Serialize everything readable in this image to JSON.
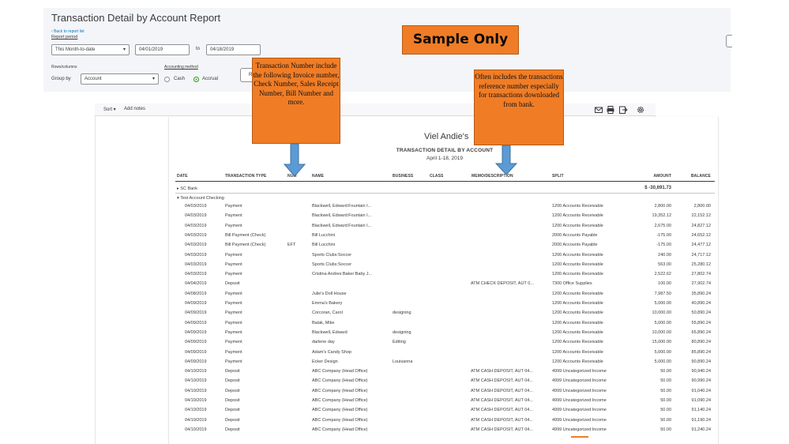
{
  "header": {
    "title": "Transaction Detail by Account Report",
    "back_link": "Back to report list",
    "report_period_label": "Report period",
    "period_value": "This Month-to-date",
    "date_from": "04/01/2019",
    "to_label": "to",
    "date_to": "04/18/2019",
    "rows_columns_label": "Rows/columns",
    "group_by_label": "Group by",
    "group_by_value": "Account",
    "accounting_method_label": "Accounting method",
    "cash_label": "Cash",
    "accrual_label": "Accrual",
    "accrual_selected": true,
    "run_report_button": "R"
  },
  "stamp": "Sample Only",
  "toolbar": {
    "sort_label": "Sort ▾",
    "add_notes_label": "Add notes",
    "icons": [
      "email-icon",
      "print-icon",
      "export-icon",
      "gear-icon"
    ]
  },
  "report": {
    "company": "Viel Andie's",
    "heading": "TRANSACTION DETAIL BY ACCOUNT",
    "date_range": "April 1-18, 2019",
    "columns": {
      "date": "DATE",
      "type": "TRANSACTION TYPE",
      "num": "NUM",
      "name": "NAME",
      "business": "BUSINESS",
      "class": "CLASS",
      "memo": "MEMO/DESCRIPTION",
      "split": "SPLIT",
      "amount": "AMOUNT",
      "balance": "BALANCE"
    },
    "group_sc_bank": "▸ SC Bank",
    "group_sc_bank_total": "$ -30,691.73",
    "group_checking": "▾ Test Account Checking",
    "rows": [
      {
        "date": "04/03/2019",
        "type": "Payment",
        "num": "",
        "name": "Blackwell, Edward:Fountain I...",
        "business": "",
        "memo": "",
        "split": "1200 Accounts Receivable",
        "amount": "2,800.00",
        "balance": "2,800.00"
      },
      {
        "date": "04/03/2019",
        "type": "Payment",
        "num": "",
        "name": "Blackwell, Edward:Fountain I...",
        "business": "",
        "memo": "",
        "split": "1200 Accounts Receivable",
        "amount": "19,352.12",
        "balance": "22,152.12"
      },
      {
        "date": "04/03/2019",
        "type": "Payment",
        "num": "",
        "name": "Blackwell, Edward:Fountain I...",
        "business": "",
        "memo": "",
        "split": "1200 Accounts Receivable",
        "amount": "2,675.00",
        "balance": "24,827.12"
      },
      {
        "date": "04/03/2019",
        "type": "Bill Payment (Check)",
        "num": "",
        "name": "Bill Lucchini",
        "business": "",
        "memo": "",
        "split": "2000 Accounts Payable",
        "amount": "-175.00",
        "balance": "24,652.12"
      },
      {
        "date": "04/03/2019",
        "type": "Bill Payment (Check)",
        "num": "EFT",
        "name": "Bill Lucchini",
        "business": "",
        "memo": "",
        "split": "2000 Accounts Payable",
        "amount": "-175.00",
        "balance": "24,477.12"
      },
      {
        "date": "04/03/2019",
        "type": "Payment",
        "num": "",
        "name": "Sports Clubs:Soccer",
        "business": "",
        "memo": "",
        "split": "1200 Accounts Receivable",
        "amount": "240.00",
        "balance": "24,717.12"
      },
      {
        "date": "04/03/2019",
        "type": "Payment",
        "num": "",
        "name": "Sports Clubs:Soccer",
        "business": "",
        "memo": "",
        "split": "1200 Accounts Receivable",
        "amount": "563.00",
        "balance": "25,280.12"
      },
      {
        "date": "04/03/2019",
        "type": "Payment",
        "num": "",
        "name": "Cristina Andres:Baker:Baby J...",
        "business": "",
        "memo": "",
        "split": "1200 Accounts Receivable",
        "amount": "2,522.62",
        "balance": "27,802.74"
      },
      {
        "date": "04/04/2019",
        "type": "Deposit",
        "num": "",
        "name": "",
        "business": "",
        "memo": "ATM CHECK DEPOSIT, AUT 0...",
        "split": "7300 Office Supplies",
        "amount": "100.00",
        "balance": "27,902.74"
      },
      {
        "date": "04/08/2019",
        "type": "Payment",
        "num": "",
        "name": "Julie's Doll House",
        "business": "",
        "memo": "",
        "split": "1200 Accounts Receivable",
        "amount": "7,987.50",
        "balance": "35,890.24"
      },
      {
        "date": "04/09/2019",
        "type": "Payment",
        "num": "",
        "name": "Emma's Bakery",
        "business": "",
        "memo": "",
        "split": "1200 Accounts Receivable",
        "amount": "5,000.00",
        "balance": "40,890.24"
      },
      {
        "date": "04/09/2019",
        "type": "Payment",
        "num": "",
        "name": "Corcoran, Carol",
        "business": "designing",
        "memo": "",
        "split": "1200 Accounts Receivable",
        "amount": "10,000.00",
        "balance": "50,890.24"
      },
      {
        "date": "04/09/2019",
        "type": "Payment",
        "num": "",
        "name": "Balak, Mike",
        "business": "",
        "memo": "",
        "split": "1200 Accounts Receivable",
        "amount": "5,000.00",
        "balance": "55,890.24"
      },
      {
        "date": "04/09/2019",
        "type": "Payment",
        "num": "",
        "name": "Blackwell, Edward",
        "business": "designing",
        "memo": "",
        "split": "1200 Accounts Receivable",
        "amount": "10,000.00",
        "balance": "65,890.24"
      },
      {
        "date": "04/09/2019",
        "type": "Payment",
        "num": "",
        "name": "darlene day",
        "business": "Editing",
        "memo": "",
        "split": "1200 Accounts Receivable",
        "amount": "15,000.00",
        "balance": "80,890.24"
      },
      {
        "date": "04/09/2019",
        "type": "Payment",
        "num": "",
        "name": "Adam's Candy Shop",
        "business": "",
        "memo": "",
        "split": "1200 Accounts Receivable",
        "amount": "5,000.00",
        "balance": "85,890.24"
      },
      {
        "date": "04/09/2019",
        "type": "Payment",
        "num": "",
        "name": "Ecker Design",
        "business": "Louisanna",
        "memo": "",
        "split": "1200 Accounts Receivable",
        "amount": "5,000.00",
        "balance": "90,890.24"
      },
      {
        "date": "04/10/2019",
        "type": "Deposit",
        "num": "",
        "name": "ABC Company (Head Office)",
        "business": "",
        "memo": "ATM CASH DEPOSIT, AUT 04...",
        "split": "4999 Uncategorized Income",
        "amount": "50.00",
        "balance": "90,940.24"
      },
      {
        "date": "04/10/2019",
        "type": "Deposit",
        "num": "",
        "name": "ABC Company (Head Office)",
        "business": "",
        "memo": "ATM CASH DEPOSIT, AUT 04...",
        "split": "4999 Uncategorized Income",
        "amount": "50.00",
        "balance": "90,990.24"
      },
      {
        "date": "04/10/2019",
        "type": "Deposit",
        "num": "",
        "name": "ABC Company (Head Office)",
        "business": "",
        "memo": "ATM CASH DEPOSIT, AUT 04...",
        "split": "4999 Uncategorized Income",
        "amount": "50.00",
        "balance": "91,040.24"
      },
      {
        "date": "04/10/2019",
        "type": "Deposit",
        "num": "",
        "name": "ABC Company (Head Office)",
        "business": "",
        "memo": "ATM CASH DEPOSIT, AUT 04...",
        "split": "4999 Uncategorized Income",
        "amount": "50.00",
        "balance": "91,090.24"
      },
      {
        "date": "04/10/2019",
        "type": "Deposit",
        "num": "",
        "name": "ABC Company (Head Office)",
        "business": "",
        "memo": "ATM CASH DEPOSIT, AUT 04...",
        "split": "4999 Uncategorized Income",
        "amount": "50.00",
        "balance": "91,140.24"
      },
      {
        "date": "04/10/2019",
        "type": "Deposit",
        "num": "",
        "name": "ABC Company (Head Office)",
        "business": "",
        "memo": "ATM CASH DEPOSIT, AUT 04...",
        "split": "4999 Uncategorized Income",
        "amount": "50.00",
        "balance": "91,190.24"
      },
      {
        "date": "04/10/2019",
        "type": "Deposit",
        "num": "",
        "name": "ABC Company (Head Office)",
        "business": "",
        "memo": "ATM CASH DEPOSIT, AUT 04...",
        "split": "4999 Uncategorized Income",
        "amount": "50.00",
        "balance": "91,240.24"
      }
    ]
  },
  "callouts": {
    "num_note": "Transaction Number include the following Invoice number, Check Number, Sales Receipt Number, Bill Number and more.",
    "memo_note": "Often includes the transactions reference number especially for transactions downloaded  from bank."
  },
  "colors": {
    "callout": "#f07d26",
    "arrow": "#5b9bd5",
    "accent_green": "#2ca01c",
    "link_blue": "#0077c5"
  }
}
